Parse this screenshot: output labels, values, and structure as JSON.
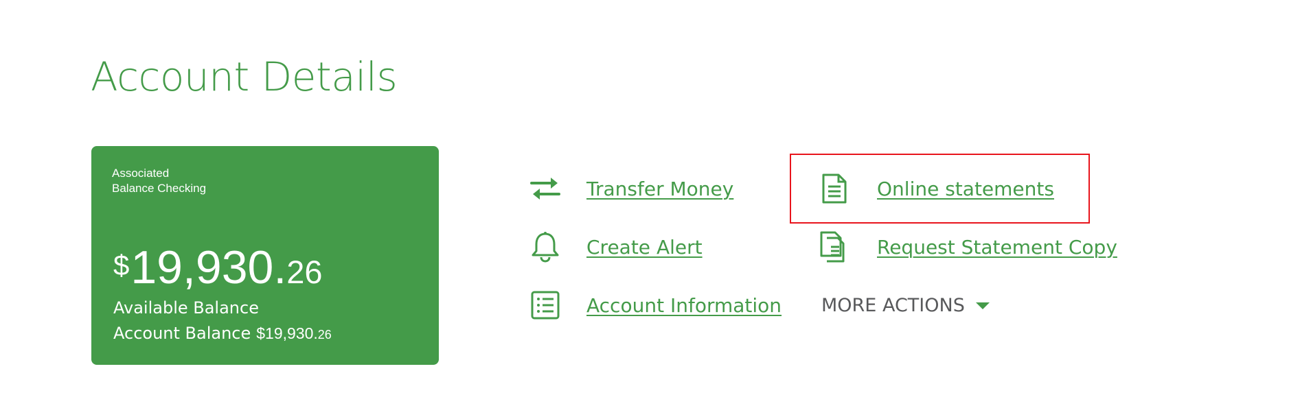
{
  "page": {
    "title": "Account Details"
  },
  "account": {
    "name_line1": "Associated",
    "name_line2": "Balance Checking",
    "currency": "$",
    "available_whole": "19,930.",
    "available_cents": "26",
    "available_label": "Available Balance",
    "account_balance_label": "Account Balance",
    "account_balance_whole": "$19,930.",
    "account_balance_cents": "26"
  },
  "actions": {
    "transfer_money": "Transfer Money",
    "create_alert": "Create Alert",
    "account_information": "Account Information",
    "online_statements": "Online statements",
    "request_statement_copy": "Request Statement Copy",
    "more_actions": "MORE ACTIONS"
  },
  "colors": {
    "brand_green": "#449b49",
    "highlight_red": "#e8141c",
    "muted_text": "#58595b"
  }
}
